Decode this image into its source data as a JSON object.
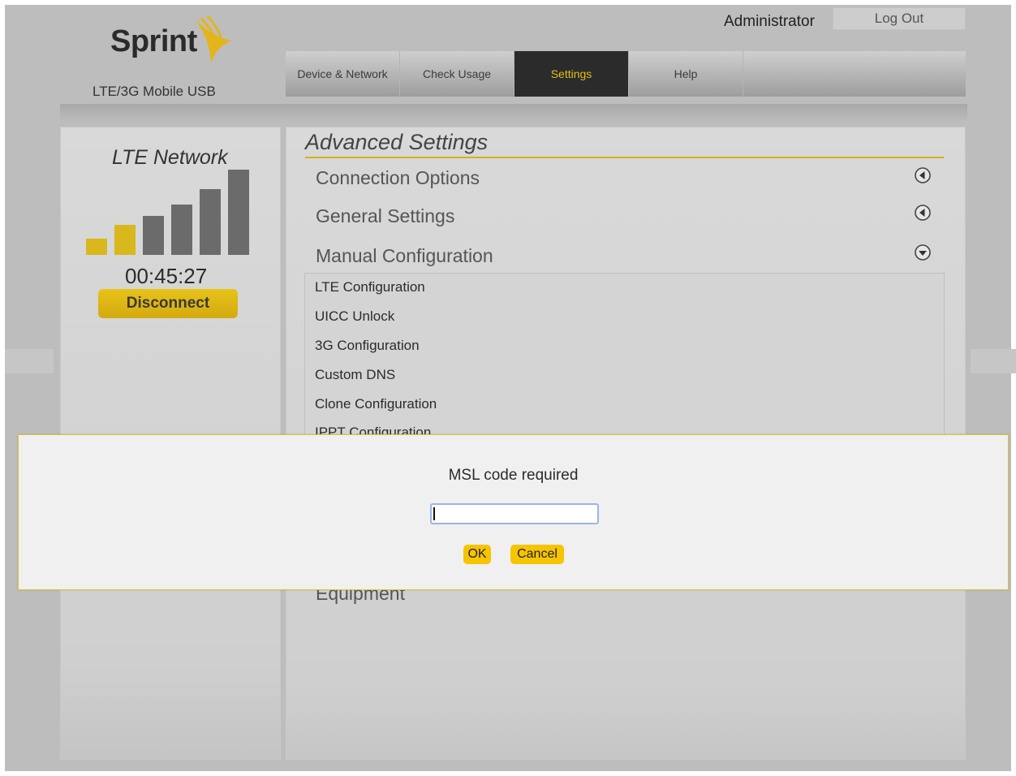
{
  "header": {
    "logo_text": "Sprint",
    "subtitle": "LTE/3G Mobile USB",
    "user_label": "Administrator",
    "logout_label": "Log Out"
  },
  "tabs": [
    {
      "label": "Device & Network",
      "active": false
    },
    {
      "label": "Check Usage",
      "active": false
    },
    {
      "label": "Settings",
      "active": true
    },
    {
      "label": "Help",
      "active": false
    }
  ],
  "status": {
    "network_label": "LTE Network",
    "signal_bars_total": 6,
    "signal_bars_lit": 2,
    "timer": "00:45:27",
    "disconnect_label": "Disconnect"
  },
  "main": {
    "title": "Advanced Settings",
    "sections": [
      {
        "label": "Connection Options",
        "state": "collapsed"
      },
      {
        "label": "General Settings",
        "state": "collapsed"
      },
      {
        "label": "Manual Configuration",
        "state": "expanded"
      }
    ],
    "manual_config_items": [
      "LTE Configuration",
      "UICC Unlock",
      "3G Configuration",
      "Custom DNS",
      "Clone Configuration",
      "IPPT Configuration"
    ],
    "partial_section": "Equipment"
  },
  "dialog": {
    "message": "MSL code required",
    "input_value": "",
    "ok_label": "OK",
    "cancel_label": "Cancel"
  },
  "colors": {
    "accent": "#d8b81c",
    "active_tab_bg": "#2b2b2b",
    "button_yellow": "#f6c400"
  }
}
